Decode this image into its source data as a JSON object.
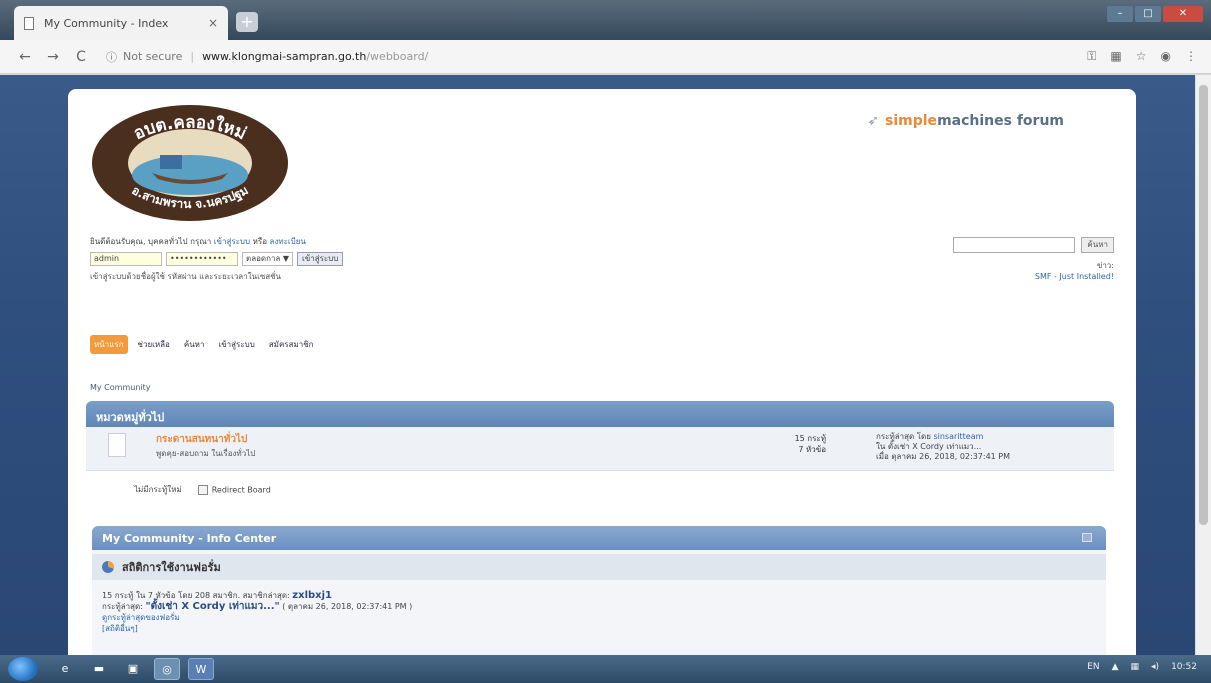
{
  "browser": {
    "tab_title": "My Community - Index",
    "tab_close": "×",
    "new_tab": "+",
    "security": "Not secure",
    "url_host": "www.klongmai-sampran.go.th",
    "url_path": "/webboard/"
  },
  "header": {
    "logo_top_text": "อบต.คลองใหม่",
    "logo_bottom_text": "อ.สามพราน จ.นครปฐม",
    "brand_simple": "simple",
    "brand_rest": "machines forum"
  },
  "user_area": {
    "greeting_text": "ยินดีต้อนรับคุณ, บุคคลทั่วไป กรุณา",
    "login_link": "เข้าสู่ระบบ",
    "or_text": "หรือ",
    "register_link": "ลงทะเบียน",
    "username_value": "admin",
    "password_value": "••••••••••••",
    "duration_value": "ตลอดกาล ▼",
    "login_button": "เข้าสู่ระบบ",
    "note": "เข้าสู่ระบบด้วยชื่อผู้ใช้ รหัสผ่าน และระยะเวลาในเซสชั่น"
  },
  "search": {
    "button": "ค้นหา",
    "news_label": "ข่าว:",
    "news_link": "SMF - Just Installed!"
  },
  "menu": {
    "items": [
      "หน้าแรก",
      "ช่วยเหลือ",
      "ค้นหา",
      "เข้าสู่ระบบ",
      "สมัครสมาชิก"
    ]
  },
  "breadcrumb": "My Community",
  "category": {
    "title": "หมวดหมู่ทั่วไป",
    "board": {
      "name": "กระดานสนทนาทั่วไป",
      "desc": "พูดคุย-สอบถาม ในเรื่องทั่วไป",
      "posts": "15 กระทู้",
      "topics": "7 หัวข้อ",
      "last_post_label": "กระทู้ล่าสุด",
      "last_post_by": "โดย",
      "last_post_user": "sinsaritteam",
      "last_post_in": "ใน ตั้งเช่า X Cordy เท่าแมว...",
      "last_post_date": "เมื่อ ตุลาคม 26, 2018, 02:37:41 PM"
    },
    "legend_new": "ไม่มีกระทู้ใหม่",
    "legend_redirect": "Redirect Board"
  },
  "info_center": {
    "title": "My Community - Info Center",
    "stats_heading": "สถิติการใช้งานฟอรั่ม",
    "stats_line_prefix": "15 กระทู้ ใน 7 หัวข้อ โดย 208 สมาชิก. สมาชิกล่าสุด:",
    "latest_member": "zxlbxj1",
    "latest_post_prefix": "กระทู้ล่าสุด:",
    "latest_post_title": "\"ตั้งเช่า X Cordy เท่าแมว...\"",
    "latest_post_date": "( ตุลาคม 26, 2018, 02:37:41 PM )",
    "recent_link": "ดูกระทู้ล่าสุดของฟอรั่ม",
    "more_stats": "[สถิติอื่นๆ]"
  },
  "taskbar": {
    "lang": "EN",
    "time": "10:52"
  }
}
